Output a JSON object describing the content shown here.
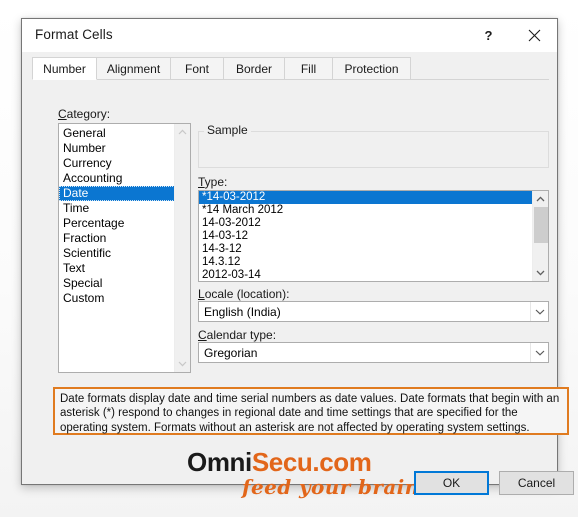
{
  "dialog": {
    "title": "Format Cells",
    "help_icon": "question-mark-icon",
    "close_icon": "close-icon"
  },
  "tabs": [
    {
      "label": "Number",
      "active": true
    },
    {
      "label": "Alignment",
      "active": false
    },
    {
      "label": "Font",
      "active": false
    },
    {
      "label": "Border",
      "active": false
    },
    {
      "label": "Fill",
      "active": false
    },
    {
      "label": "Protection",
      "active": false
    }
  ],
  "category": {
    "label": "Category:",
    "accel": "C",
    "items": [
      "General",
      "Number",
      "Currency",
      "Accounting",
      "Date",
      "Time",
      "Percentage",
      "Fraction",
      "Scientific",
      "Text",
      "Special",
      "Custom"
    ],
    "selected": "Date",
    "selected_index": 4
  },
  "sample": {
    "legend": "Sample",
    "value": ""
  },
  "type": {
    "label": "Type:",
    "accel": "T",
    "items": [
      "*14-03-2012",
      "*14 March 2012",
      "14-03-2012",
      "14-03-12",
      "14-3-12",
      "14.3.12",
      "2012-03-14"
    ],
    "selected": "*14-03-2012",
    "selected_index": 0
  },
  "locale": {
    "label": "Locale (location):",
    "accel": "L",
    "value": "English (India)"
  },
  "calendar": {
    "label": "Calendar type:",
    "accel": "C",
    "value": "Gregorian"
  },
  "description": {
    "text": "Date formats display date and time serial numbers as date values.  Date formats that begin with an asterisk (*) respond to changes in regional date and time settings that are specified for the operating system. Formats without an asterisk are not affected by operating system settings."
  },
  "watermark": {
    "brand_part1": "Omni",
    "brand_part2": "Secu.com",
    "tagline": "feed your brain"
  },
  "buttons": {
    "ok": "OK",
    "cancel": "Cancel"
  },
  "colors": {
    "selection_blue": "#0b76d1",
    "focus_blue": "#0078d7",
    "description_border_orange": "#e07b20",
    "brand_orange": "#e2661a",
    "dialog_background": "#f0f0f0"
  }
}
